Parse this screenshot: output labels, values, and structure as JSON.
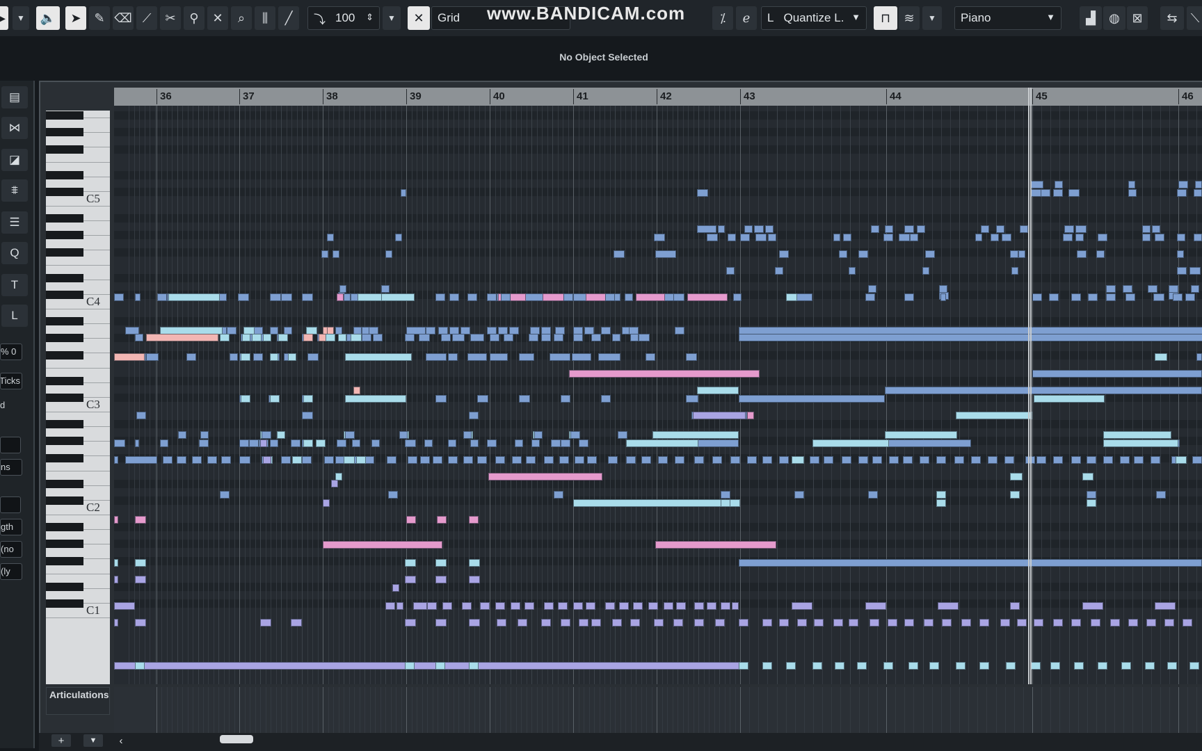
{
  "toolbar": {
    "velocity_value": "100",
    "grid_label": "Grid",
    "quantize_label": "Quantize L.",
    "instrument_label": "Piano",
    "tool_icons": [
      "play-icon",
      "dropdown-icon",
      "mute-speaker-icon",
      "arrow-select-icon",
      "pencil-icon",
      "eraser-icon",
      "brush-icon",
      "scissors-icon",
      "glue-icon",
      "mute-x-icon",
      "zoom-icon",
      "comp-icon",
      "line-icon"
    ]
  },
  "watermark": "www.BANDICAM.com",
  "info_line": "No Object Selected",
  "inspector": {
    "buttons": [
      "▤",
      "⋈",
      "◪",
      "⩨",
      "☰",
      "Q",
      "T",
      "L"
    ],
    "percent": "0 %",
    "fields": [
      "Ticks",
      "d",
      "",
      "ns",
      "",
      "gth",
      "no)",
      "ly)"
    ]
  },
  "ruler": {
    "bars": [
      "36",
      "37",
      "38",
      "39",
      "40",
      "41",
      "42",
      "43",
      "44",
      "45",
      "46"
    ]
  },
  "keyboard": {
    "c_labels": [
      "C5",
      "C4",
      "C3",
      "C2",
      "C1"
    ]
  },
  "articulations_label": "Articulations",
  "colors": {
    "note_blue": "#7e9fd1",
    "note_cyan": "#a9dcea",
    "note_pink": "#e59acc",
    "note_purple": "#a9a4e3",
    "note_salmon": "#f2b6b3"
  }
}
